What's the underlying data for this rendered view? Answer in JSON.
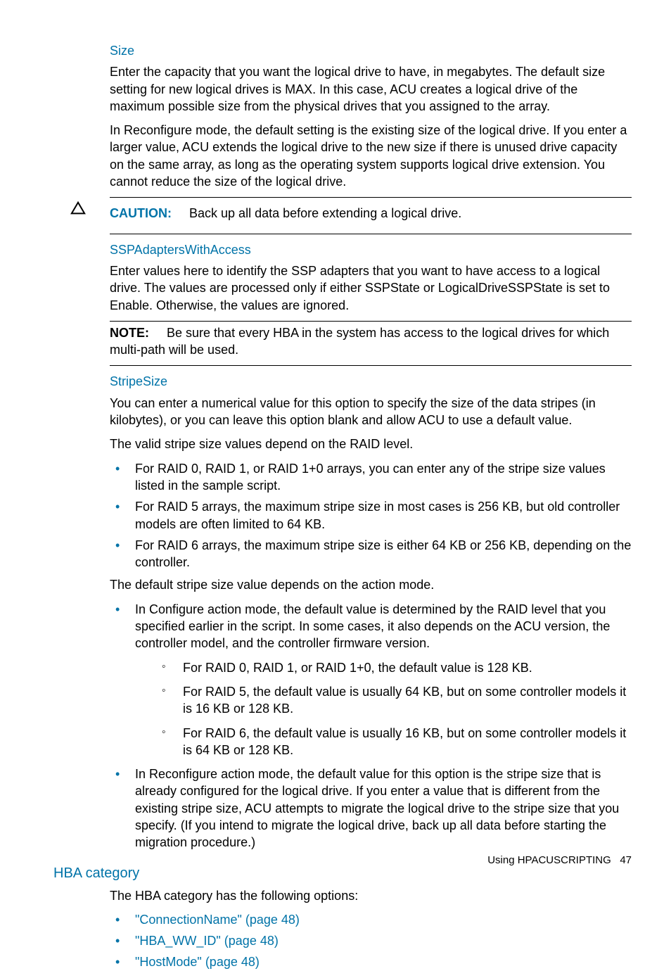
{
  "size": {
    "heading": "Size",
    "p1": "Enter the capacity that you want the logical drive to have, in megabytes. The default size setting for new logical drives is MAX. In this case, ACU creates a logical drive of the maximum possible size from the physical drives that you assigned to the array.",
    "p2": "In Reconfigure mode, the default setting is the existing size of the logical drive. If you enter a larger value, ACU extends the logical drive to the new size if there is unused drive capacity on the same array, as long as the operating system supports logical drive extension. You cannot reduce the size of the logical drive."
  },
  "caution": {
    "label": "CAUTION:",
    "text": "Back up all data before extending a logical drive."
  },
  "ssp": {
    "heading": "SSPAdaptersWithAccess",
    "p1": "Enter values here to identify the SSP adapters that you want to have access to a logical drive. The values are processed only if either SSPState or LogicalDriveSSPState is set to Enable. Otherwise, the values are ignored."
  },
  "note": {
    "label": "NOTE:",
    "text": "Be sure that every HBA in the system has access to the logical drives for which multi-path will be used."
  },
  "stripe": {
    "heading": "StripeSize",
    "p1": "You can enter a numerical value for this option to specify the size of the data stripes (in kilobytes), or you can leave this option blank and allow ACU to use a default value.",
    "p2": "The valid stripe size values depend on the RAID level.",
    "bullets1": [
      "For RAID 0, RAID 1, or RAID 1+0 arrays, you can enter any of the stripe size values listed in the sample script.",
      "For RAID 5 arrays, the maximum stripe size in most cases is 256 KB, but old controller models are often limited to 64 KB.",
      "For RAID 6 arrays, the maximum stripe size is either 64 KB or 256 KB, depending on the controller."
    ],
    "p3": "The default stripe size value depends on the action mode.",
    "configure_intro": "In Configure action mode, the default value is determined by the RAID level that you specified earlier in the script. In some cases, it also depends on the ACU version, the controller model, and the controller firmware version.",
    "configure_sub": [
      "For RAID 0, RAID 1, or RAID 1+0, the default value is 128 KB.",
      "For RAID 5, the default value is usually 64 KB, but on some controller models it is 16 KB or 128 KB.",
      "For RAID 6, the default value is usually 16 KB, but on some controller models it is 64 KB or 128 KB."
    ],
    "reconfigure": "In Reconfigure action mode, the default value for this option is the stripe size that is already configured for the logical drive. If you enter a value that is different from the existing stripe size, ACU attempts to migrate the logical drive to the stripe size that you specify. (If you intend to migrate the logical drive, back up all data before starting the migration procedure.)"
  },
  "hba": {
    "heading": "HBA category",
    "intro": "The HBA category has the following options:",
    "links": [
      "\"ConnectionName\" (page 48)",
      "\"HBA_WW_ID\" (page 48)",
      "\"HostMode\" (page 48)"
    ]
  },
  "footer": {
    "text": "Using HPACUSCRIPTING",
    "page": "47"
  }
}
